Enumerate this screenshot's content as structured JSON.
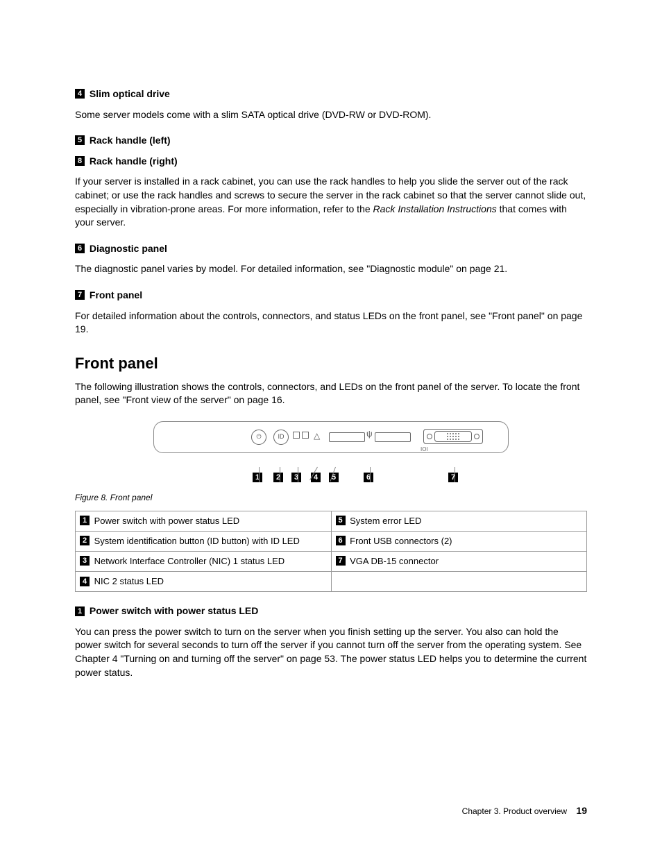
{
  "items": {
    "i4": {
      "num": "4",
      "title": "Slim optical drive",
      "body": "Some server models come with a slim SATA optical drive (DVD-RW or DVD-ROM)."
    },
    "i5": {
      "num": "5",
      "title": "Rack handle (left)"
    },
    "i8": {
      "num": "8",
      "title": "Rack handle (right)"
    },
    "rack_body_1": "If your server is installed in a rack cabinet, you can use the rack handles to help you slide the server out of the rack cabinet; or use the rack handles and screws to secure the server in the rack cabinet so that the server cannot slide out, especially in vibration-prone areas. For more information, refer to the ",
    "rack_body_em": "Rack Installation Instructions",
    "rack_body_2": " that comes with your server.",
    "i6": {
      "num": "6",
      "title": "Diagnostic panel",
      "body": "The diagnostic panel varies by model. For detailed information, see \"Diagnostic module\" on page 21."
    },
    "i7": {
      "num": "7",
      "title": "Front panel",
      "body": "For detailed information about the controls, connectors, and status LEDs on the front panel, see \"Front panel\" on page 19."
    }
  },
  "section": {
    "heading": "Front panel",
    "intro": "The following illustration shows the controls, connectors, and LEDs on the front panel of the server. To locate the front panel, see \"Front view of the server\" on page 16."
  },
  "figure": {
    "caption": "Figure 8.  Front panel",
    "labels": [
      "1",
      "2",
      "3",
      "4",
      "5",
      "6",
      "7"
    ]
  },
  "table": {
    "rows": [
      {
        "ln": "1",
        "lt": "Power switch with power status LED",
        "rn": "5",
        "rt": "System error LED"
      },
      {
        "ln": "2",
        "lt": "System identification button (ID button) with ID LED",
        "rn": "6",
        "rt": "Front USB connectors (2)"
      },
      {
        "ln": "3",
        "lt": "Network Interface Controller (NIC) 1 status LED",
        "rn": "7",
        "rt": "VGA DB-15 connector"
      },
      {
        "ln": "4",
        "lt": "NIC 2 status LED",
        "rn": "",
        "rt": ""
      }
    ]
  },
  "power": {
    "num": "1",
    "title": "Power switch with power status LED",
    "body": "You can press the power switch to turn on the server when you finish setting up the server. You also can hold the power switch for several seconds to turn off the server if you cannot turn off the server from the operating system. See Chapter 4 \"Turning on and turning off the server\" on page 53. The power status LED helps you to determine the current power status."
  },
  "footer": {
    "chapter": "Chapter 3.  Product overview",
    "page": "19"
  }
}
